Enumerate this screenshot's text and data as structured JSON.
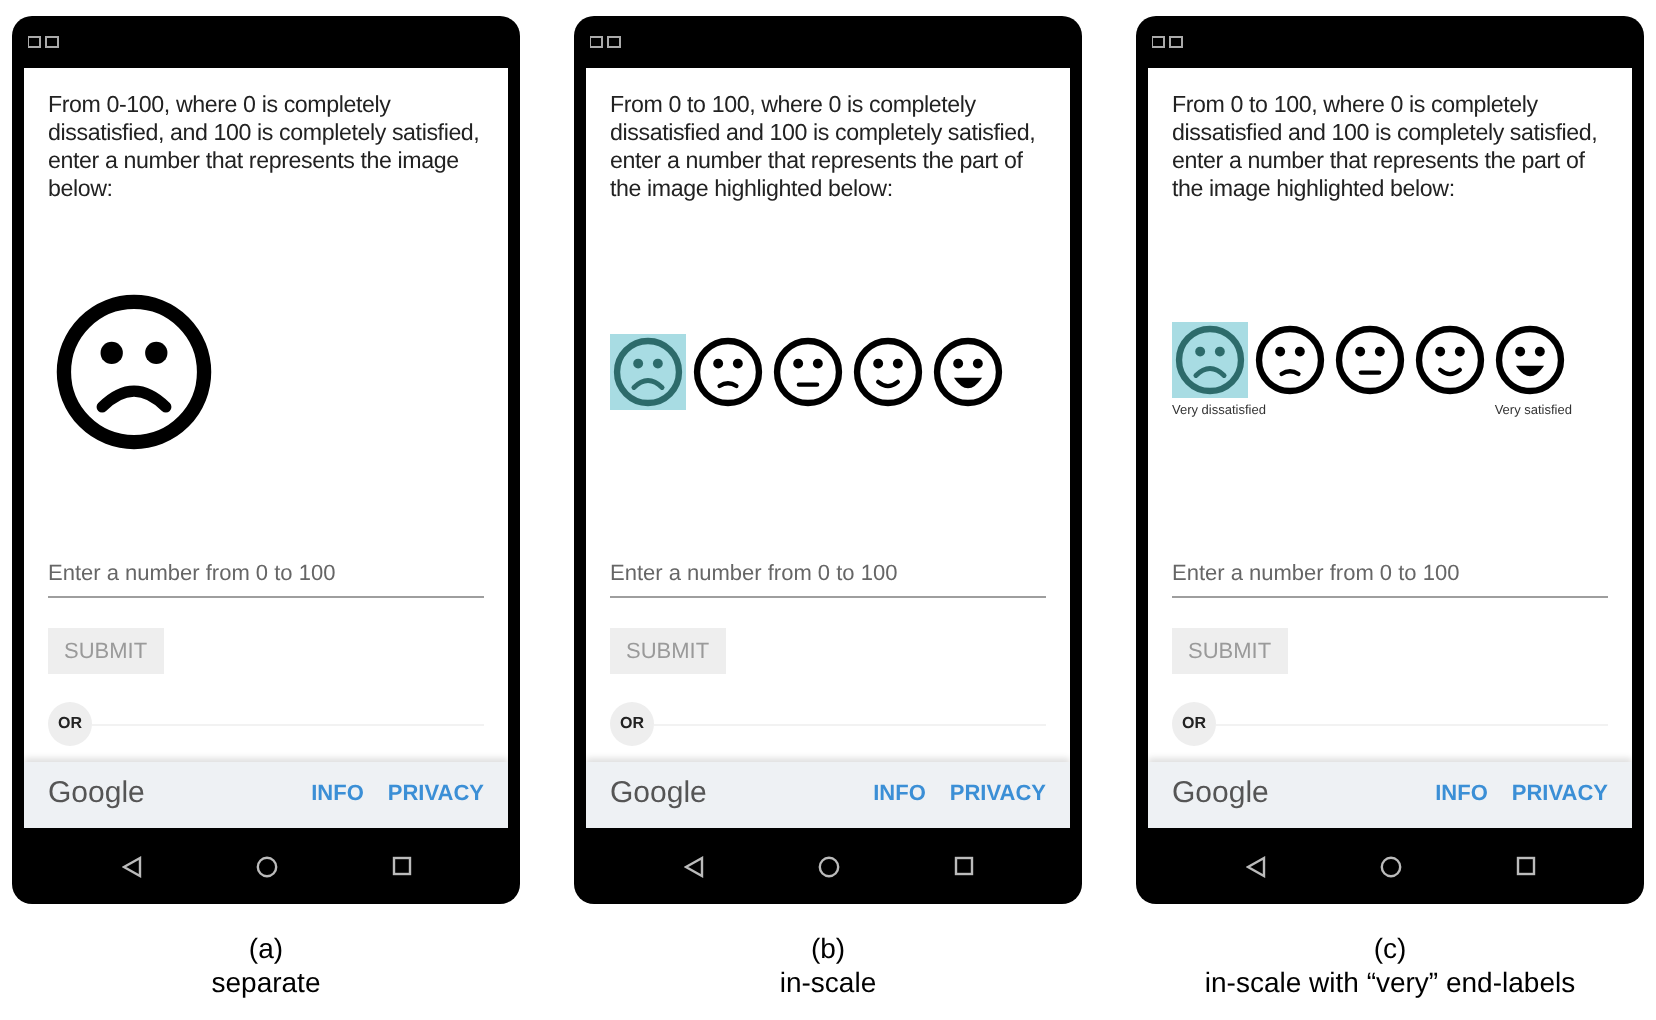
{
  "panels": [
    {
      "prompt": "From 0-100, where 0 is completely dissatisfied, and 100 is completely satisfied, enter a number that represents the image below:",
      "faces": [
        {
          "kind": "very-sad",
          "selected": false
        }
      ],
      "input": {
        "placeholder": "Enter a number from 0 to 100"
      },
      "submit": {
        "label": "SUBMIT",
        "disabled": true
      },
      "or_label": "OR",
      "footer": {
        "brand": "Google",
        "links": [
          "INFO",
          "PRIVACY"
        ]
      },
      "caption": {
        "letter": "(a)",
        "text": "separate"
      }
    },
    {
      "prompt": "From 0 to 100, where 0 is completely dissatisfied and 100 is completely satisfied, enter a number that represents the part of the image highlighted below:",
      "faces": [
        {
          "kind": "very-sad",
          "selected": true
        },
        {
          "kind": "sad",
          "selected": false
        },
        {
          "kind": "neutral",
          "selected": false
        },
        {
          "kind": "happy",
          "selected": false
        },
        {
          "kind": "very-happy",
          "selected": false
        }
      ],
      "input": {
        "placeholder": "Enter a number from 0 to 100"
      },
      "submit": {
        "label": "SUBMIT",
        "disabled": true
      },
      "or_label": "OR",
      "footer": {
        "brand": "Google",
        "links": [
          "INFO",
          "PRIVACY"
        ]
      },
      "caption": {
        "letter": "(b)",
        "text": "in-scale"
      }
    },
    {
      "prompt": "From 0 to 100, where 0 is completely dissatisfied and 100 is completely satisfied, enter a number that represents the part of the image highlighted below:",
      "faces": [
        {
          "kind": "very-sad",
          "selected": true
        },
        {
          "kind": "sad",
          "selected": false
        },
        {
          "kind": "neutral",
          "selected": false
        },
        {
          "kind": "happy",
          "selected": false
        },
        {
          "kind": "very-happy",
          "selected": false
        }
      ],
      "end_labels": [
        "Very dissatisfied",
        "Very satisfied"
      ],
      "input": {
        "placeholder": "Enter a number from 0 to 100"
      },
      "submit": {
        "label": "SUBMIT",
        "disabled": true
      },
      "or_label": "OR",
      "footer": {
        "brand": "Google",
        "links": [
          "INFO",
          "PRIVACY"
        ]
      },
      "caption": {
        "letter": "(c)",
        "text": "in-scale with “very” end-labels"
      }
    }
  ]
}
